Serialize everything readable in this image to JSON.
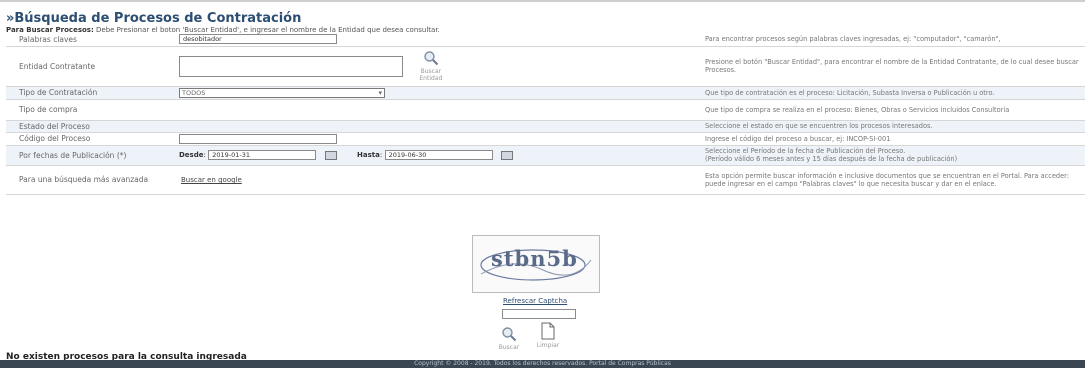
{
  "page": {
    "title": "»Búsqueda de Procesos de Contratación",
    "instructions_bold": "Para Buscar Procesos:",
    "instructions_rest": " Debe Presionar el boton 'Buscar Entidad', e ingresar el nombre de la Entidad que desea consultar."
  },
  "form": {
    "keywords": {
      "label": "Palabras claves",
      "value": "desobitador",
      "help": "Para encontrar procesos según palabras claves ingresadas, ej: \"computador\", \"camarón\","
    },
    "entity": {
      "label": "Entidad Contratante",
      "button_label_1": "Buscar",
      "button_label_2": "Entidad",
      "help": "Presione el botón \"Buscar Entidad\", para encontrar el nombre de la Entidad Contratante, de lo cual desee buscar Procesos."
    },
    "contract_type": {
      "label": "Tipo de Contratación",
      "value": "TODOS",
      "help": "Que tipo de contratación es el proceso: Licitación, Subasta Inversa o Publicación u otro."
    },
    "purchase_type": {
      "label": "Tipo de compra",
      "help": "Que tipo de compra se realiza en el proceso: Bienes, Obras o Servicios incluidos Consultoría"
    },
    "process_state": {
      "label": "Estado del Proceso",
      "help": "Seleccione el estado en que se encuentren los procesos interesados."
    },
    "process_code": {
      "label": "Código del Proceso",
      "value": "",
      "help": "Ingrese el código del proceso a buscar, ej: INCOP-SI-001"
    },
    "publication_dates": {
      "label": "Por fechas de Publicación (*)",
      "from_label": "Desde",
      "from_value": "2019-01-31",
      "to_label": "Hasta",
      "to_value": "2019-06-30",
      "help_1": "Seleccione el Período de la fecha de Publicación del Proceso.",
      "help_2": "(Período válido 6 meses antes y 15 días después de la fecha de publicación)"
    },
    "advanced": {
      "label": "Para una búsqueda más avanzada",
      "link": "Buscar en google",
      "help": "Esta opción permite buscar información e inclusive documentos que se encuentran en el Portal. Para acceder: puede ingresar en el campo \"Palabras claves\" lo que necesita buscar y dar en el enlace."
    }
  },
  "captcha": {
    "text": "stbn5b",
    "refresh_label": "Refrescar Captcha",
    "input_value": ""
  },
  "actions": {
    "search_label": "Buscar",
    "clear_label": "Limpiar"
  },
  "result": {
    "message": "No existen procesos para la consulta ingresada"
  },
  "footer": {
    "copyright": "Copyright © 2008 - 2019. Todos los derechos reservados. Portal de Compras Públicas"
  },
  "icons": {
    "search": "magnifier-icon",
    "clear": "document-icon",
    "calendar": "calendar-icon",
    "dropdown": "chevron-down-icon"
  },
  "colors": {
    "title": "#2b4e72",
    "alt_row": "#eef3f9",
    "footer_bar": "#3a4652"
  }
}
